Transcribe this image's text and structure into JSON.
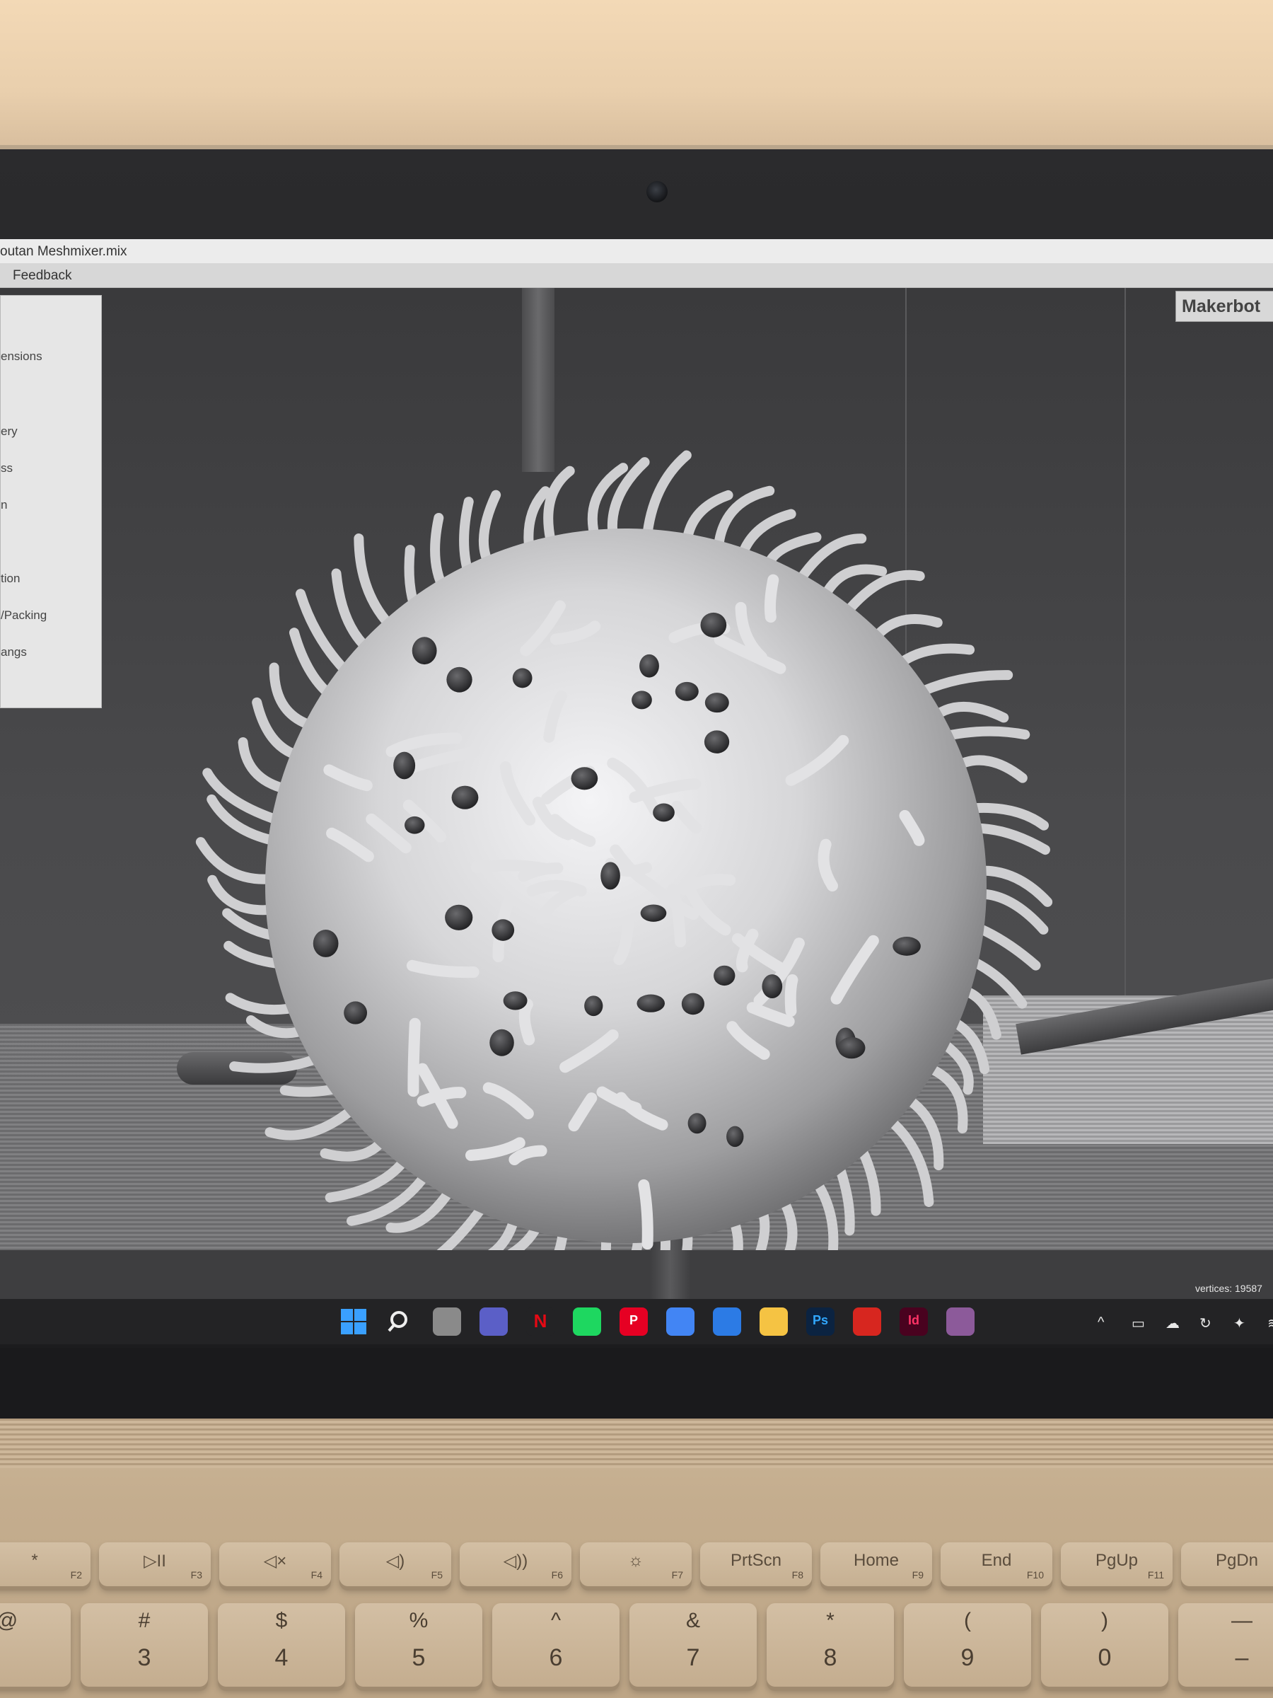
{
  "window": {
    "title": "outan Meshmixer.mix"
  },
  "menu": {
    "feedback": "Feedback"
  },
  "side_panel": {
    "items": [
      "ensions",
      "ery",
      "ss",
      "n",
      "tion",
      "/Packing",
      "angs"
    ]
  },
  "printer_label": "Makerbot",
  "status": {
    "vertices": "vertices: 19587"
  },
  "taskbar": {
    "apps": [
      {
        "name": "start-icon",
        "glyph": "",
        "color": "#1a8cff"
      },
      {
        "name": "search-icon",
        "glyph": "",
        "color": "transparent"
      },
      {
        "name": "task-view-icon",
        "glyph": "",
        "color": "#8a8a8a"
      },
      {
        "name": "teams-chat-icon",
        "glyph": "",
        "color": "#5b5fc7"
      },
      {
        "name": "netflix-icon",
        "glyph": "N",
        "color": "#232325"
      },
      {
        "name": "spotify-icon",
        "glyph": "",
        "color": "#1ed760"
      },
      {
        "name": "pinterest-icon",
        "glyph": "P",
        "color": "#e60023"
      },
      {
        "name": "chrome-icon",
        "glyph": "",
        "color": "#4285f4"
      },
      {
        "name": "microsoft-store-icon",
        "glyph": "",
        "color": "#2c7be5"
      },
      {
        "name": "file-explorer-icon",
        "glyph": "",
        "color": "#f5c343"
      },
      {
        "name": "photoshop-icon",
        "glyph": "Ps",
        "color": "#0b2341"
      },
      {
        "name": "acrobat-icon",
        "glyph": "",
        "color": "#d7261f"
      },
      {
        "name": "indesign-icon",
        "glyph": "Id",
        "color": "#49021f"
      },
      {
        "name": "meshmixer-icon",
        "glyph": "",
        "color": "#8c5a9a"
      }
    ],
    "tray_glyphs": [
      "^",
      "▭",
      "☁",
      "↻",
      "✦",
      "≋"
    ]
  },
  "keyboard": {
    "fn_row": [
      {
        "label": "*",
        "fn": "F2"
      },
      {
        "label": "▷II",
        "fn": "F3"
      },
      {
        "label": "◁×",
        "fn": "F4"
      },
      {
        "label": "◁)",
        "fn": "F5"
      },
      {
        "label": "◁))",
        "fn": "F6"
      },
      {
        "label": "☼",
        "fn": "F7"
      },
      {
        "label": "PrtScn",
        "fn": "F8"
      },
      {
        "label": "Home",
        "fn": "F9"
      },
      {
        "label": "End",
        "fn": "F10"
      },
      {
        "label": "PgUp",
        "fn": "F11"
      },
      {
        "label": "PgDn",
        "fn": ""
      }
    ],
    "num_row": [
      {
        "top": "@",
        "bottom": ""
      },
      {
        "top": "#",
        "bottom": "3"
      },
      {
        "top": "$",
        "bottom": "4"
      },
      {
        "top": "%",
        "bottom": "5"
      },
      {
        "top": "^",
        "bottom": "6"
      },
      {
        "top": "&",
        "bottom": "7"
      },
      {
        "top": "*",
        "bottom": "8"
      },
      {
        "top": "(",
        "bottom": "9"
      },
      {
        "top": ")",
        "bottom": "0"
      },
      {
        "top": "—",
        "bottom": "–"
      }
    ]
  }
}
